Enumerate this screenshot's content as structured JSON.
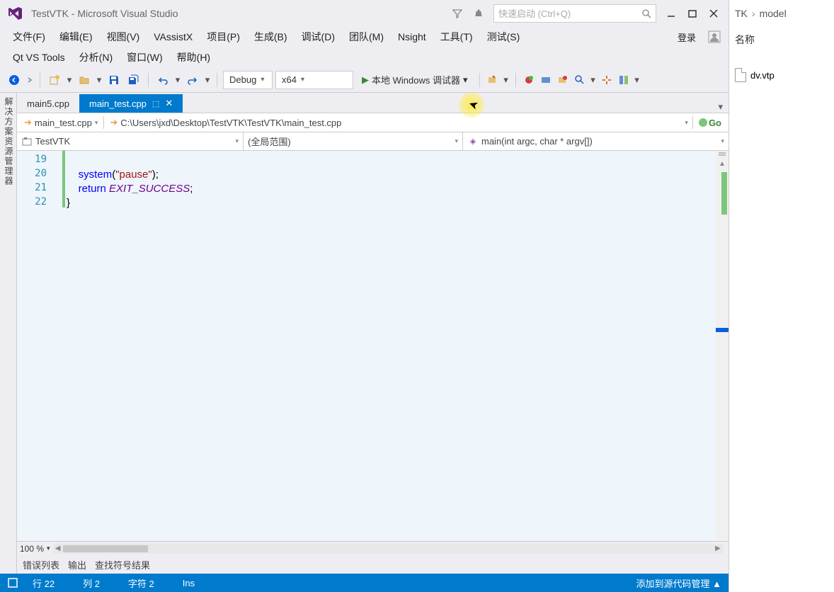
{
  "title": "TestVTK - Microsoft Visual Studio",
  "quick_launch_placeholder": "快速启动 (Ctrl+Q)",
  "menu": {
    "file": "文件(F)",
    "edit": "编辑(E)",
    "view": "视图(V)",
    "vassistx": "VAssistX",
    "project": "项目(P)",
    "build": "生成(B)",
    "debug": "调试(D)",
    "team": "团队(M)",
    "nsight": "Nsight",
    "tools": "工具(T)",
    "test": "测试(S)",
    "qt": "Qt VS Tools",
    "analyze": "分析(N)",
    "window": "窗口(W)",
    "help": "帮助(H)",
    "login": "登录"
  },
  "toolbar": {
    "config": "Debug",
    "platform": "x64",
    "run_label": "本地 Windows 调试器"
  },
  "tabs": {
    "inactive": "main5.cpp",
    "active": "main_test.cpp"
  },
  "nav": {
    "file": "main_test.cpp",
    "path": "C:\\Users\\jxd\\Desktop\\TestVTK\\TestVTK\\main_test.cpp",
    "go": "Go"
  },
  "context": {
    "project": "TestVTK",
    "scope": "(全局范围)",
    "func": "main(int argc, char * argv[])"
  },
  "code": {
    "lines": [
      "19",
      "20",
      "21",
      "22"
    ],
    "l20": {
      "kw": "system",
      "paren": "(",
      "str": "\"pause\"",
      "close": ");"
    },
    "l21": {
      "kw": "return",
      "sp": " ",
      "val": "EXIT_SUCCESS",
      "semi": ";"
    },
    "l22": "}"
  },
  "zoom": "100 %",
  "bottom_tabs": {
    "errors": "错误列表",
    "output": "输出",
    "find": "查找符号结果"
  },
  "status": {
    "line": "行 22",
    "col": "列 2",
    "char": "字符 2",
    "ins": "Ins",
    "scc": "添加到源代码管理 ▲"
  },
  "side": {
    "crumb1": "TK",
    "crumb2": "model",
    "header": "名称",
    "file": "dv.vtp"
  },
  "vert_tab": "解决方案资源管理器"
}
